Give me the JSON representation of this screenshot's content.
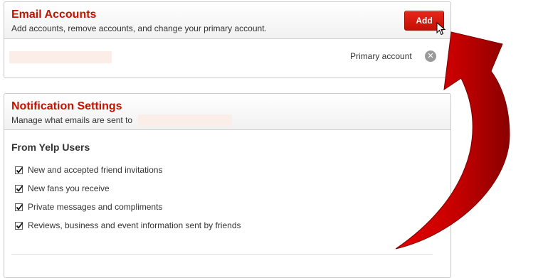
{
  "email_accounts": {
    "title": "Email Accounts",
    "subtitle": "Add accounts, remove accounts, and change your primary account.",
    "add_label": "Add",
    "primary_label": "Primary account",
    "remove_icon": "close-icon"
  },
  "notifications": {
    "title": "Notification Settings",
    "subtitle": "Manage what emails are sent to",
    "section_heading": "From Yelp Users",
    "options": [
      {
        "label": "New and accepted friend invitations",
        "checked": true
      },
      {
        "label": "New fans you receive",
        "checked": true
      },
      {
        "label": "Private messages and compliments",
        "checked": true
      },
      {
        "label": "Reviews, business and event information sent by friends",
        "checked": true
      }
    ]
  },
  "colors": {
    "accent_red": "#c41200",
    "arrow_red": "#d40000"
  }
}
